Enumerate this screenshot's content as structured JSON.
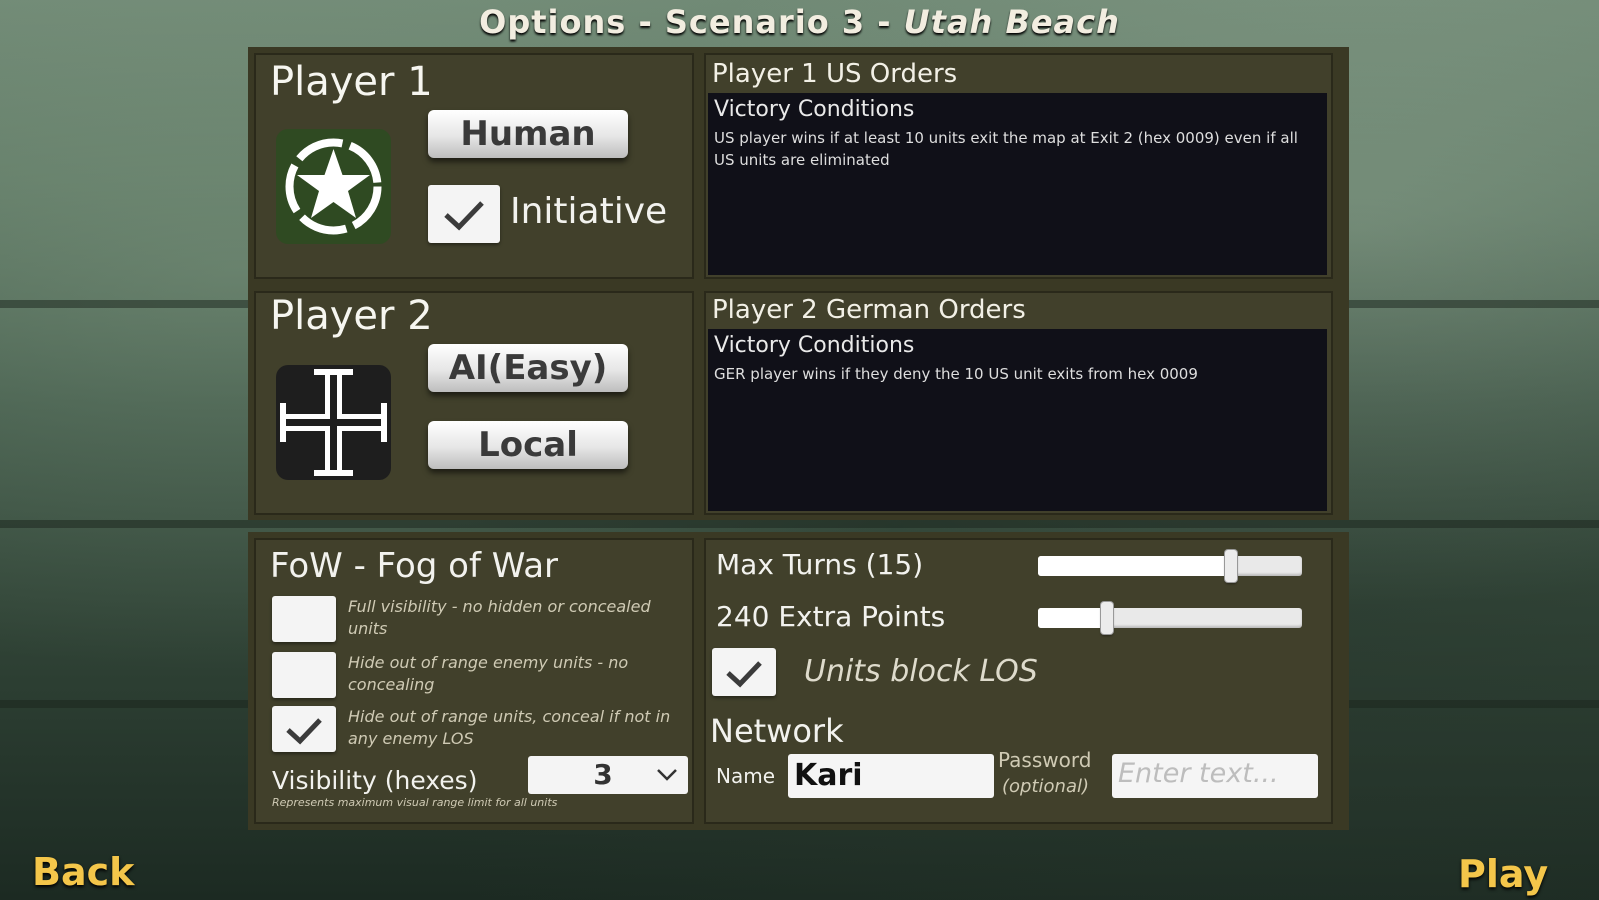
{
  "title": {
    "prefix": "Options - Scenario 3 - ",
    "map": "Utah Beach"
  },
  "player1": {
    "label": "Player 1",
    "emblem": "us-star-icon",
    "type_button": "Human",
    "initiative_label": "Initiative",
    "initiative_checked": true,
    "orders_header": "Player 1 US Orders",
    "victory_title": "Victory Conditions",
    "victory_text": "US player wins if at least 10 units exit the map at Exit 2 (hex 0009) even if all US units are eliminated"
  },
  "player2": {
    "label": "Player 2",
    "emblem": "german-cross-icon",
    "type_button": "AI(Easy)",
    "location_button": "Local",
    "orders_header": "Player 2 German Orders",
    "victory_title": "Victory Conditions",
    "victory_text": "GER player wins if they deny the 10 US unit exits from hex 0009"
  },
  "fow": {
    "title": "FoW - Fog of War",
    "options": [
      {
        "text": "Full visibility - no hidden or concealed units",
        "checked": false
      },
      {
        "text": "Hide out of range enemy units - no concealing",
        "checked": false
      },
      {
        "text": "Hide out of range units, conceal if not in any enemy LOS",
        "checked": true
      }
    ],
    "visibility_label": "Visibility (hexes)",
    "visibility_value": "3",
    "visibility_note": "Represents maximum visual range limit for all units"
  },
  "settings": {
    "max_turns_label": "Max Turns (15)",
    "max_turns_fraction": 0.73,
    "extra_points_label": "240 Extra Points",
    "extra_points_fraction": 0.26,
    "units_block_los_label": "Units block LOS",
    "units_block_los_checked": true
  },
  "network": {
    "title": "Network",
    "name_label": "Name",
    "name_value": "Kari",
    "password_label": "Password",
    "password_optional": "(optional)",
    "password_placeholder": "Enter text..."
  },
  "nav": {
    "back": "Back",
    "play": "Play"
  },
  "colors": {
    "accent": "#f4c64a",
    "panel": "#3a3924",
    "orders_bg": "#101018"
  }
}
